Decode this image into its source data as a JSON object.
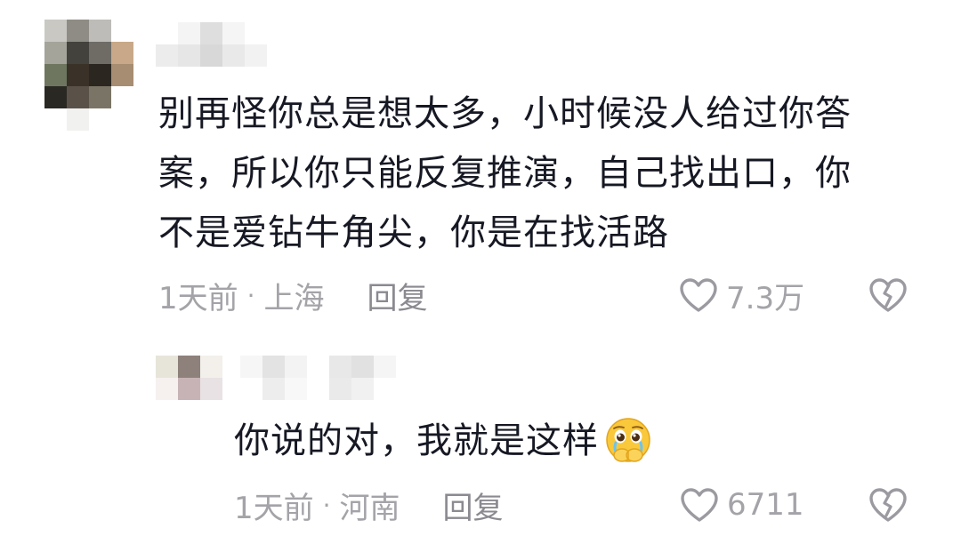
{
  "comments": [
    {
      "text_lines": [
        "别再怪你总是想太多，小时候没人给过你答",
        "案，所以你只能反复推演，自己找出口，你",
        "不是爱钻牛角尖，你是在找活路"
      ],
      "time": "1天前",
      "location": "上海",
      "reply_label": "回复",
      "likes": "7.3万"
    },
    {
      "text": "你说的对，我就是这样",
      "emoji": "pleading-face-with-hands-emoji",
      "time": "1天前",
      "location": "河南",
      "reply_label": "回复",
      "likes": "6711"
    }
  ],
  "icons": {
    "like": "heart-outline-icon",
    "dislike": "broken-heart-outline-icon"
  },
  "colors": {
    "text": "#161823",
    "meta": "#a3a3a8",
    "icon": "#9a9aa0"
  }
}
